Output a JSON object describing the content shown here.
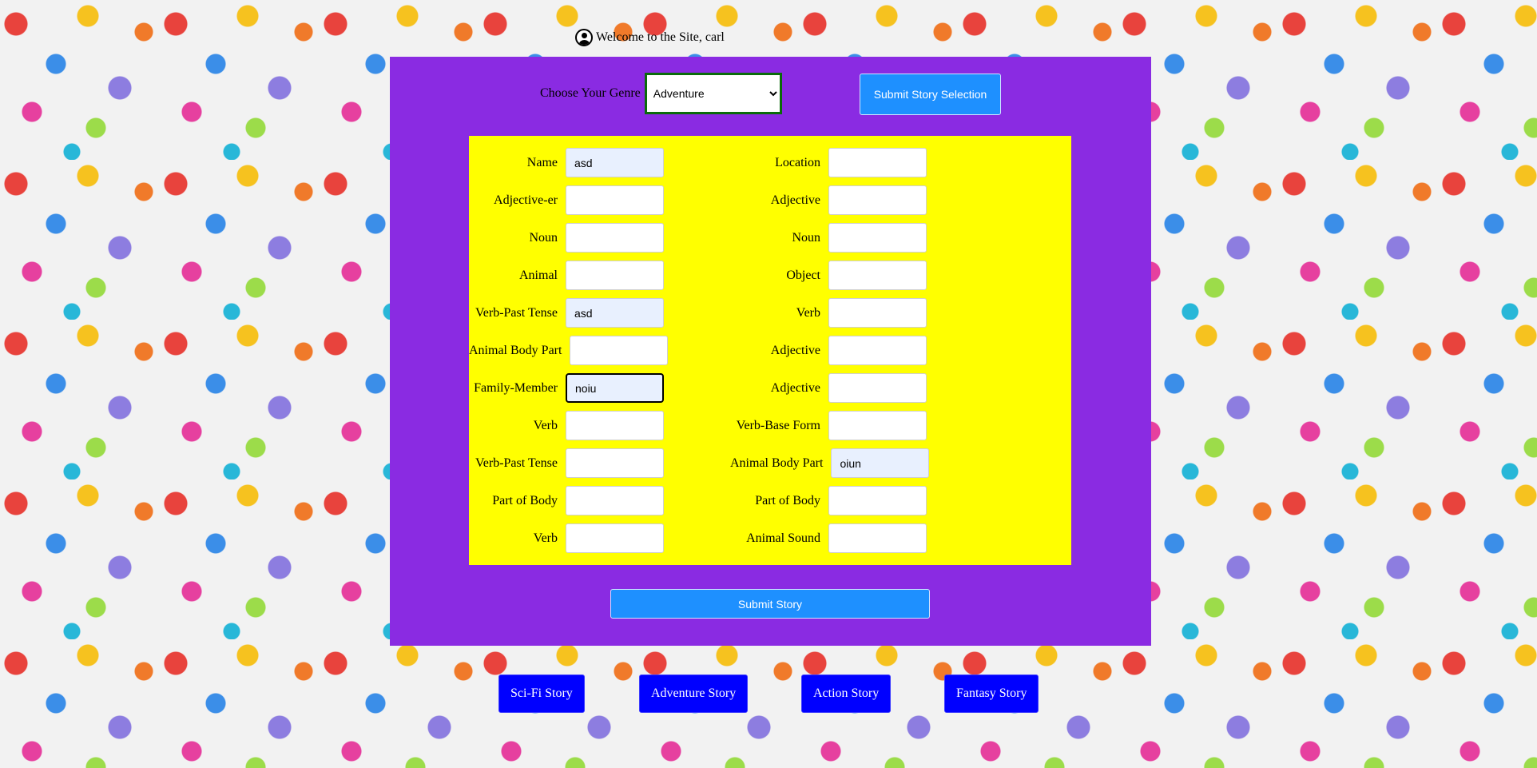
{
  "header": {
    "welcome": "Welcome to the Site, carl",
    "avatar_icon": "user-avatar-icon"
  },
  "genre": {
    "label": "Choose Your Genre",
    "selected": "Adventure",
    "submit_label": "Submit Story Selection"
  },
  "form": {
    "left": [
      {
        "label": "Name",
        "value": "asd"
      },
      {
        "label": "Adjective-er",
        "value": ""
      },
      {
        "label": "Noun",
        "value": ""
      },
      {
        "label": "Animal",
        "value": ""
      },
      {
        "label": "Verb-Past Tense",
        "value": "asd"
      },
      {
        "label": "Animal Body Part",
        "value": ""
      },
      {
        "label": "Family-Member",
        "value": "noiu"
      },
      {
        "label": "Verb",
        "value": ""
      },
      {
        "label": "Verb-Past Tense",
        "value": ""
      },
      {
        "label": "Part of Body",
        "value": ""
      },
      {
        "label": "Verb",
        "value": ""
      }
    ],
    "right": [
      {
        "label": "Location",
        "value": ""
      },
      {
        "label": "Adjective",
        "value": ""
      },
      {
        "label": "Noun",
        "value": ""
      },
      {
        "label": "Object",
        "value": ""
      },
      {
        "label": "Verb",
        "value": ""
      },
      {
        "label": "Adjective",
        "value": ""
      },
      {
        "label": "Adjective",
        "value": ""
      },
      {
        "label": "Verb-Base Form",
        "value": ""
      },
      {
        "label": "Animal Body Part",
        "value": "oiun"
      },
      {
        "label": "Part of Body",
        "value": ""
      },
      {
        "label": "Animal Sound",
        "value": ""
      }
    ],
    "submit_label": "Submit Story"
  },
  "stories": [
    "Sci-Fi Story",
    "Adventure Story",
    "Action Story",
    "Fantasy Story"
  ],
  "colors": {
    "panel": "#8a2be2",
    "form_box": "#ffff00",
    "button_blue": "#1e90ff",
    "story_blue": "#0000ff"
  }
}
